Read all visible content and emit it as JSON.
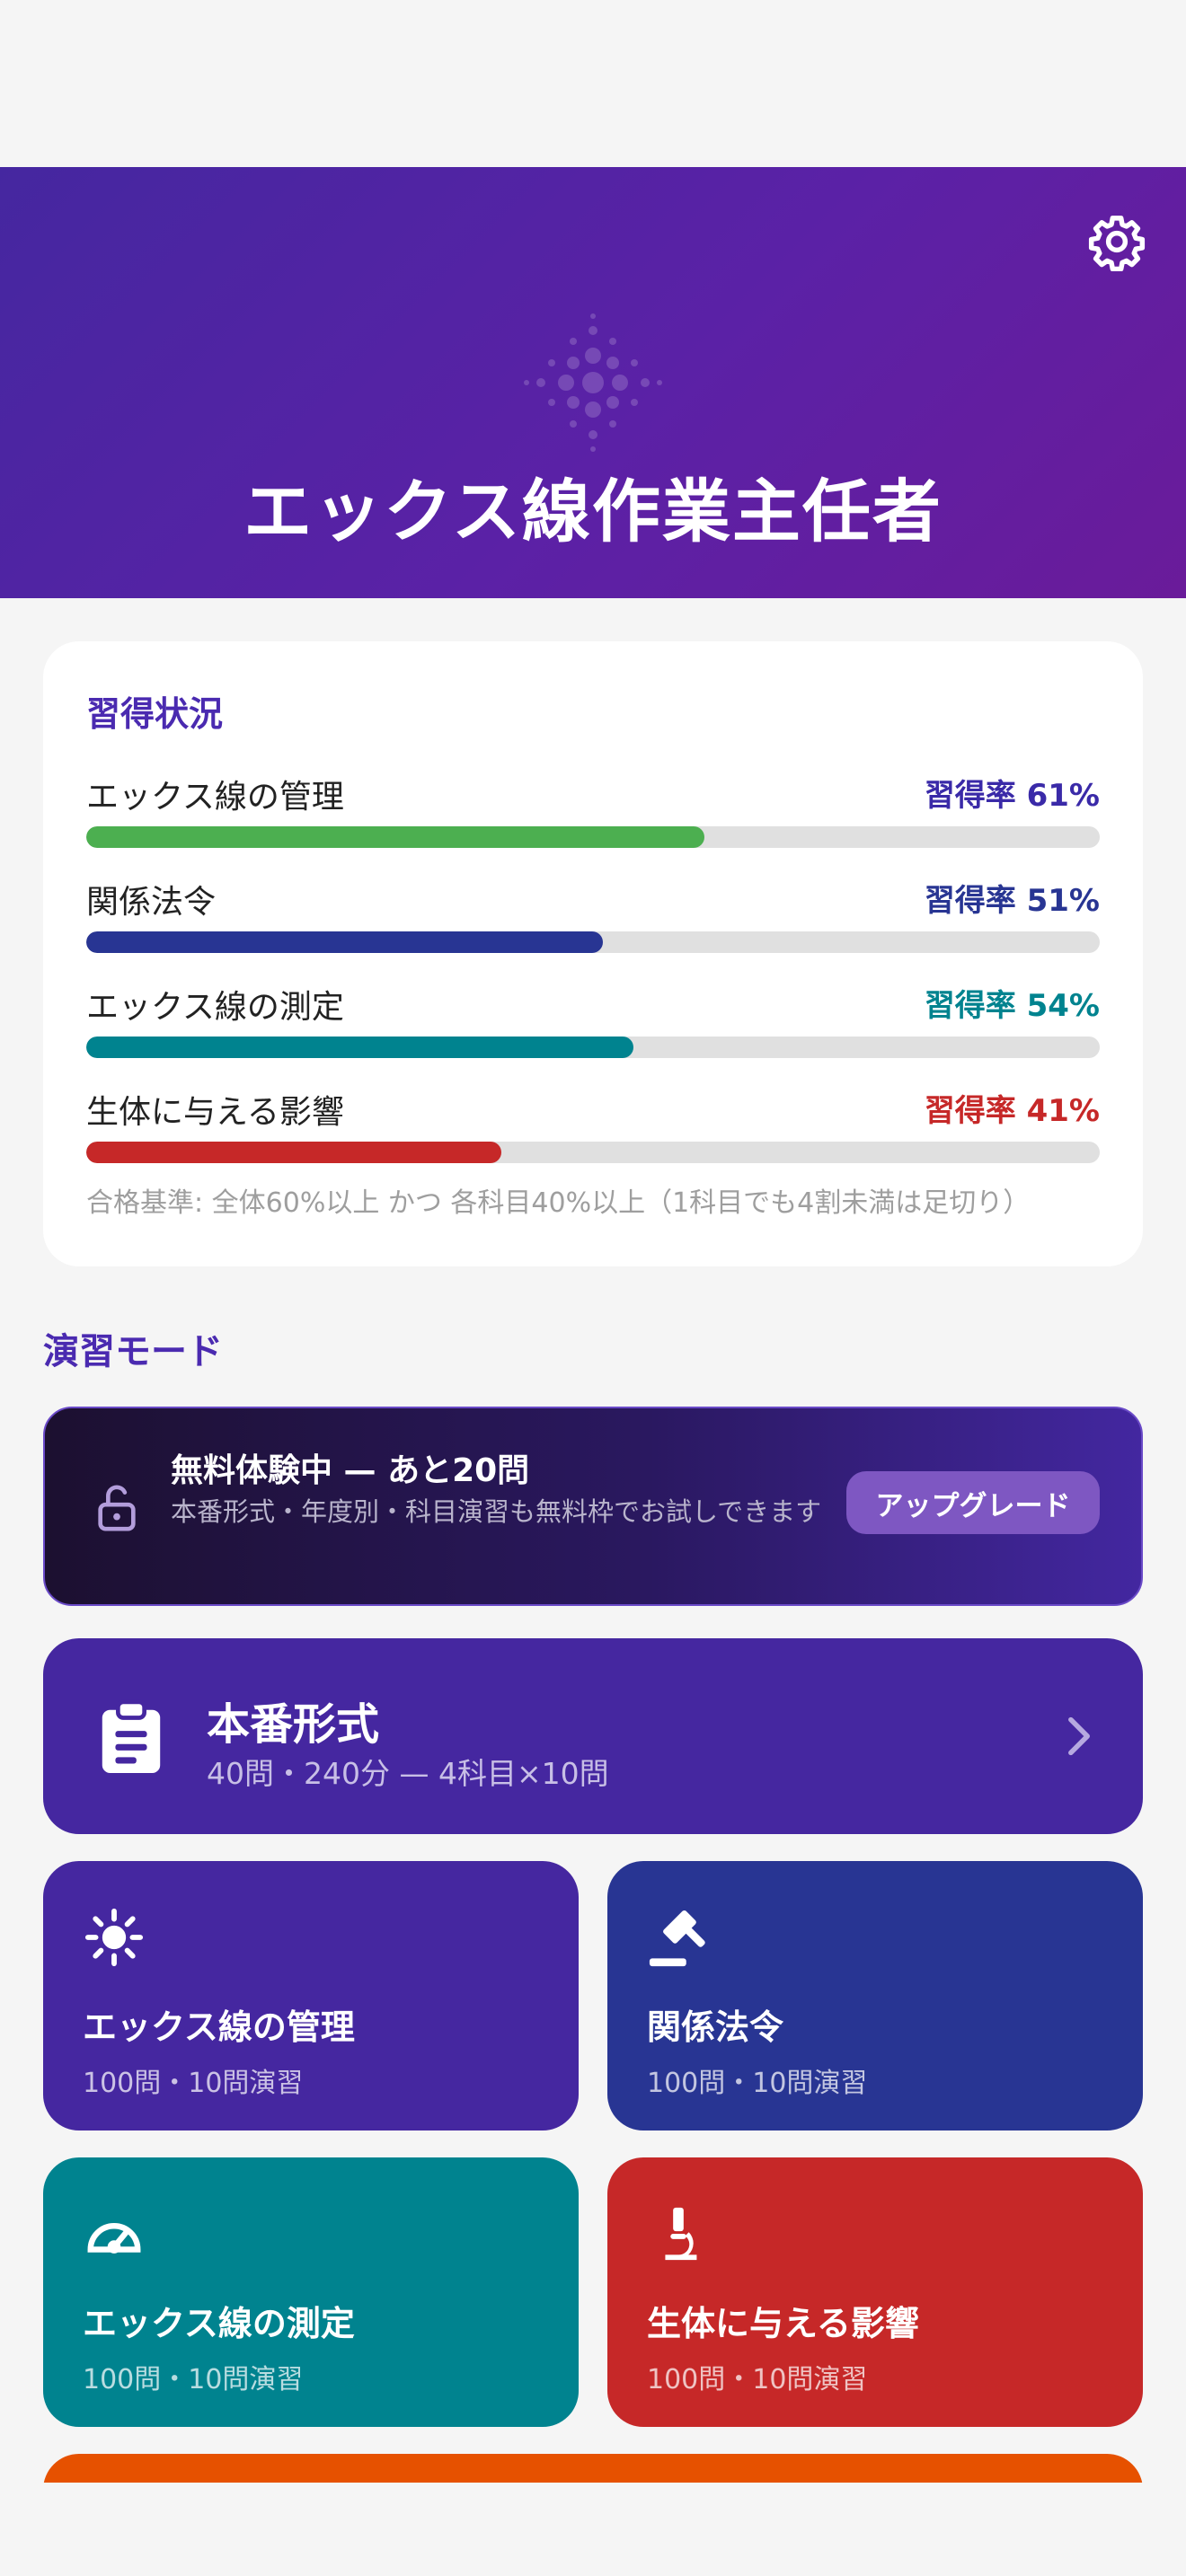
{
  "header": {
    "title": "エックス線作業主任者",
    "settings_icon": "gear-icon",
    "emblem_icon": "radiation-dots-icon",
    "gradient": [
      "#4527a0",
      "#6a1b9a"
    ]
  },
  "progress": {
    "title": "習得状況",
    "items": [
      {
        "label": "エックス線の管理",
        "rate_text": "習得率 61%",
        "value": 61,
        "color": "#4caf50",
        "rate_color": "#3a2aa8"
      },
      {
        "label": "関係法令",
        "rate_text": "習得率 51%",
        "value": 51,
        "color": "#283593",
        "rate_color": "#283593"
      },
      {
        "label": "エックス線の測定",
        "rate_text": "習得率 54%",
        "value": 54,
        "color": "#00838f",
        "rate_color": "#00838f"
      },
      {
        "label": "生体に与える影響",
        "rate_text": "習得率 41%",
        "value": 41,
        "color": "#c62828",
        "rate_color": "#c62828"
      }
    ],
    "criteria": "合格基準: 全体60%以上 かつ 各科目40%以上（1科目でも4割未満は足切り）"
  },
  "practice": {
    "title": "演習モード",
    "trial": {
      "icon": "lock-open-icon",
      "title": "無料体験中 — あと20問",
      "description": "本番形式・年度別・科目演習も無料枠でお試しできます",
      "button": "アップグレード"
    },
    "exam": {
      "icon": "clipboard-icon",
      "title": "本番形式",
      "subtitle": "40問・240分 — 4科目×10問",
      "chevron_icon": "chevron-right-icon"
    },
    "subjects": [
      {
        "title": "エックス線の管理",
        "subtitle": "100問・10問演習",
        "icon": "radiation-sun-icon",
        "color": "#4527a0"
      },
      {
        "title": "関係法令",
        "subtitle": "100問・10問演習",
        "icon": "gavel-icon",
        "color": "#283593"
      },
      {
        "title": "エックス線の測定",
        "subtitle": "100問・10問演習",
        "icon": "gauge-icon",
        "color": "#00838f"
      },
      {
        "title": "生体に与える影響",
        "subtitle": "100問・10問演習",
        "icon": "microscope-icon",
        "color": "#c62828"
      }
    ],
    "next_card_color": "#e65100"
  }
}
